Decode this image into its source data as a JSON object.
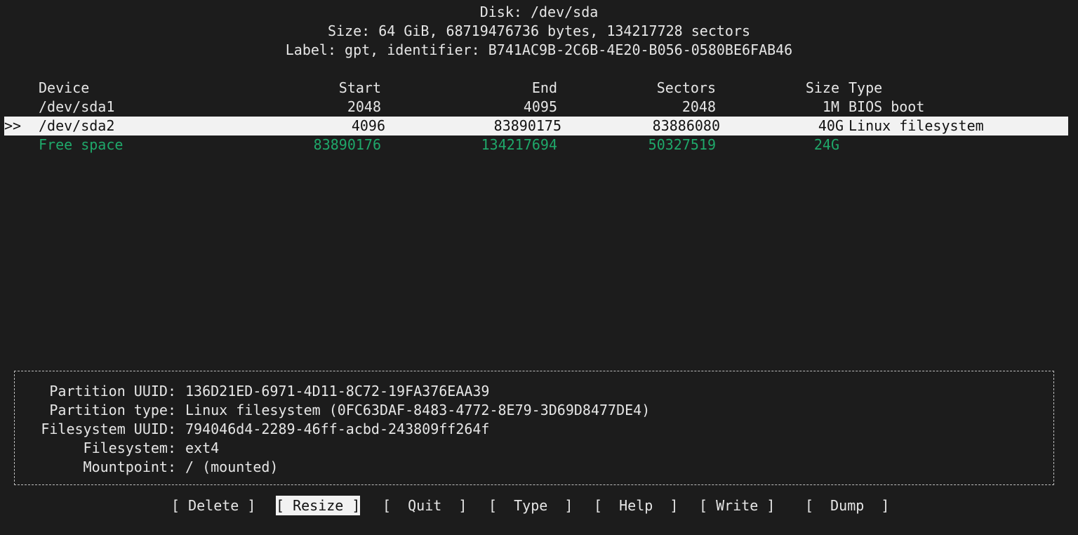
{
  "header": {
    "disk_line": "Disk: /dev/sda",
    "size_line": "Size: 64 GiB, 68719476736 bytes, 134217728 sectors",
    "label_line": "Label: gpt, identifier: B741AC9B-2C6B-4E20-B056-0580BE6FAB46"
  },
  "table": {
    "columns": {
      "device": "Device",
      "start": "Start",
      "end": "End",
      "sectors": "Sectors",
      "size": "Size",
      "type": "Type"
    },
    "selected_marker": ">>",
    "rows": [
      {
        "device": "/dev/sda1",
        "start": "2048",
        "end": "4095",
        "sectors": "2048",
        "size": "1M",
        "type": "BIOS boot"
      },
      {
        "device": "/dev/sda2",
        "start": "4096",
        "end": "83890175",
        "sectors": "83886080",
        "size": "40G",
        "type": "Linux filesystem"
      },
      {
        "device": "Free space",
        "start": "83890176",
        "end": "134217694",
        "sectors": "50327519",
        "size": "24G",
        "type": ""
      }
    ]
  },
  "info": {
    "partition_uuid_label": "Partition UUID:",
    "partition_uuid_value": "136D21ED-6971-4D11-8C72-19FA376EAA39",
    "partition_type_label": "Partition type:",
    "partition_type_value": "Linux filesystem (0FC63DAF-8483-4772-8E79-3D69D8477DE4)",
    "filesystem_uuid_label": "Filesystem UUID:",
    "filesystem_uuid_value": "794046d4-2289-46ff-acbd-243809ff264f",
    "filesystem_label": "Filesystem:",
    "filesystem_value": "ext4",
    "mountpoint_label": "Mountpoint:",
    "mountpoint_value": "/ (mounted)"
  },
  "buttons": {
    "delete": "[ Delete ]",
    "resize": "[ Resize ]",
    "quit": "[  Quit  ]",
    "type": "[  Type  ]",
    "help": "[  Help  ]",
    "write": "[ Write ]",
    "dump": "[  Dump  ]"
  },
  "colors": {
    "background": "#1c1c1c",
    "foreground": "#e6e6e6",
    "free_space": "#1fa86a",
    "selection_bg": "#f2f2f2"
  }
}
